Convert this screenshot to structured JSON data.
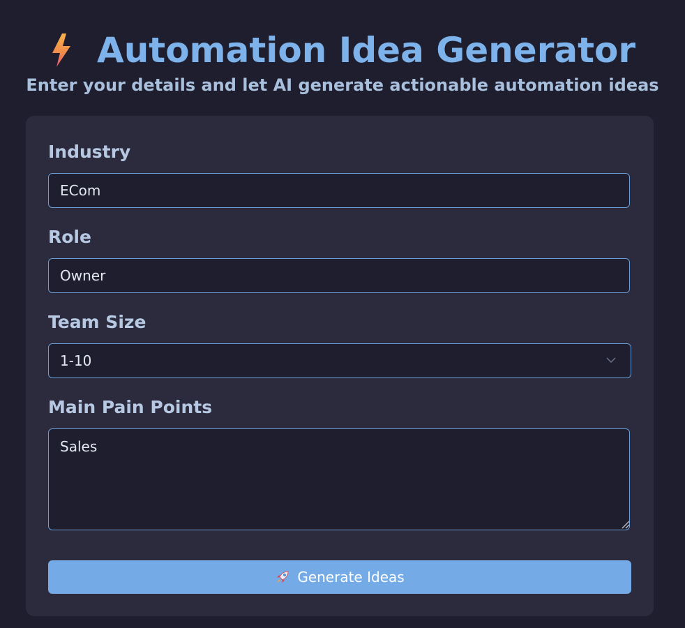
{
  "header": {
    "title": "Automation Idea Generator",
    "subtitle": "Enter your details and let AI generate actionable automation ideas",
    "title_icon": "lightning-bolt-icon"
  },
  "form": {
    "industry": {
      "label": "Industry",
      "value": "ECom"
    },
    "role": {
      "label": "Role",
      "value": "Owner"
    },
    "team_size": {
      "label": "Team Size",
      "value": "1-10"
    },
    "pain_points": {
      "label": "Main Pain Points",
      "value": "Sales"
    },
    "submit": {
      "label": "Generate Ideas",
      "icon": "rocket-icon"
    }
  },
  "colors": {
    "background": "#1e1e2e",
    "card": "#2b2b3d",
    "accent": "#74abe6",
    "title": "#7eb2ea"
  }
}
